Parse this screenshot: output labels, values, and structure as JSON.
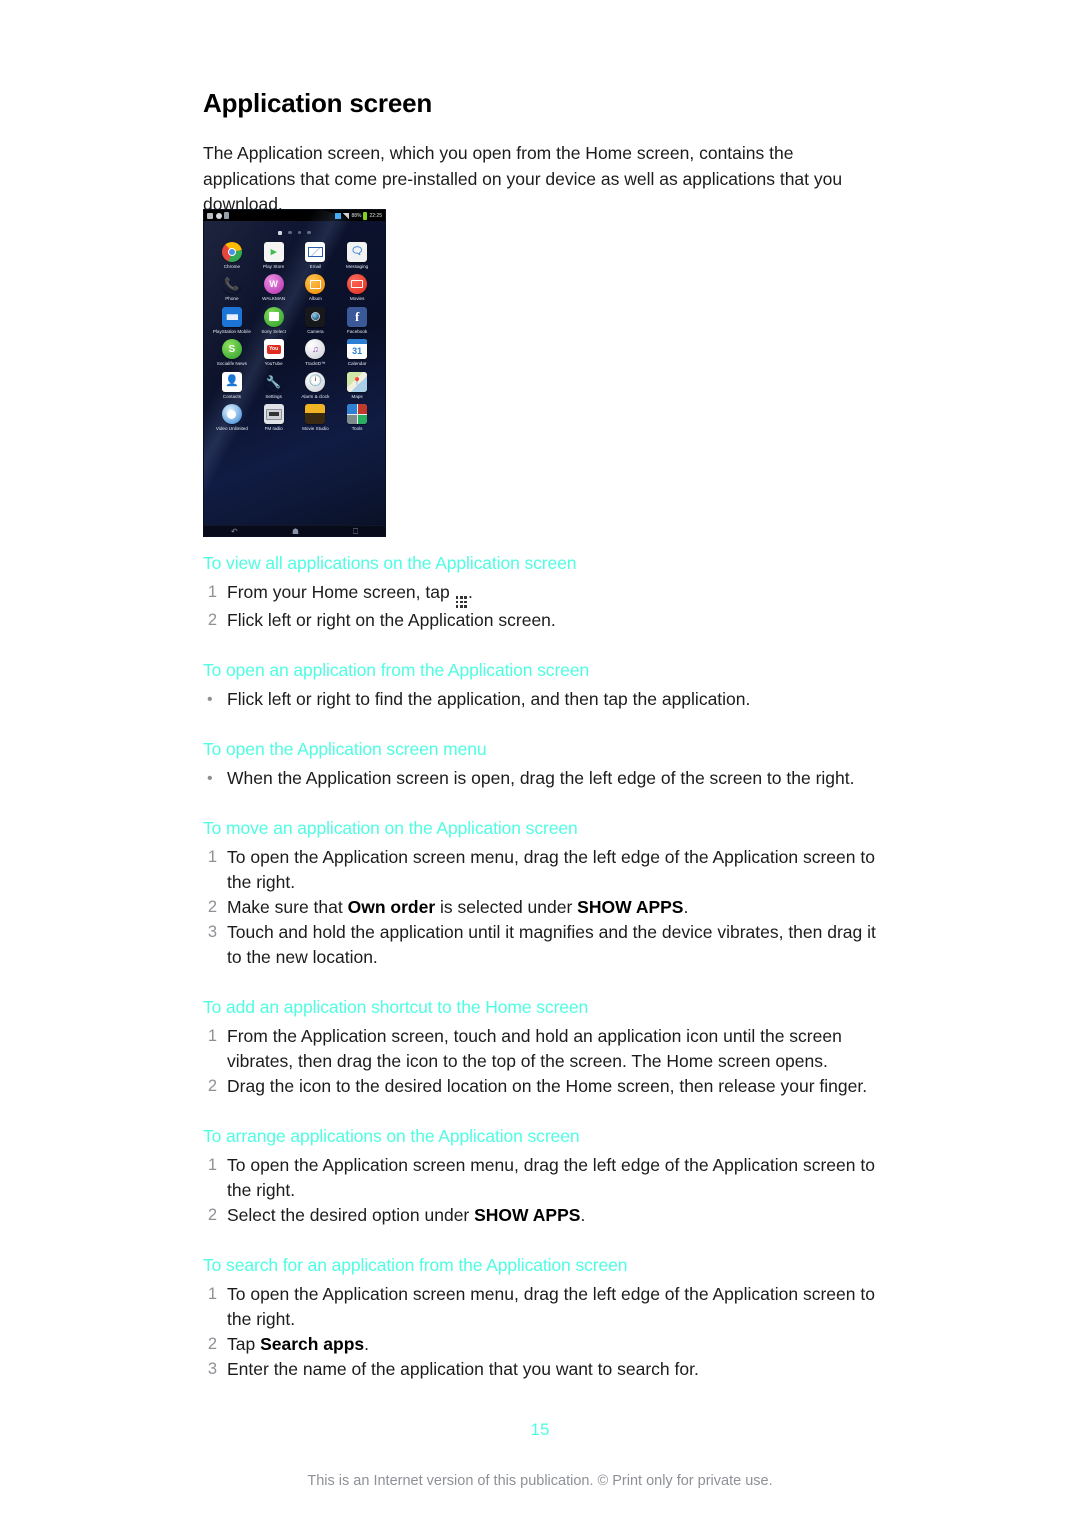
{
  "document": {
    "title": "Application screen",
    "intro": "The Application screen, which you open from the Home screen, contains the applications that come pre-installed on your device as well as applications that you download.",
    "page_number": "15",
    "footer": "This is an Internet version of this publication. © Print only for private use.",
    "heading_color": "#4FFEE2",
    "body_color": "#1c1c1c",
    "muted_color": "#8d9196"
  },
  "figure": {
    "name": "application-screen-phone-screenshot",
    "statusbar": {
      "battery": "88%",
      "clock": "22:25"
    },
    "page_indicator": {
      "total": 4,
      "selected": 1
    },
    "apps": [
      {
        "label": "Chrome",
        "icon": "chrome-icon"
      },
      {
        "label": "Play Store",
        "icon": "play-store-icon"
      },
      {
        "label": "Email",
        "icon": "email-icon"
      },
      {
        "label": "Messaging",
        "icon": "messaging-icon"
      },
      {
        "label": "Phone",
        "icon": "phone-icon"
      },
      {
        "label": "WALKMAN",
        "icon": "walkman-icon"
      },
      {
        "label": "Album",
        "icon": "album-icon"
      },
      {
        "label": "Movies",
        "icon": "movies-icon"
      },
      {
        "label": "PlayStation Mobile",
        "icon": "playstation-mobile-icon"
      },
      {
        "label": "Sony Select",
        "icon": "sony-select-icon"
      },
      {
        "label": "Camera",
        "icon": "camera-icon"
      },
      {
        "label": "Facebook",
        "icon": "facebook-icon"
      },
      {
        "label": "Socialife News",
        "icon": "socialife-news-icon"
      },
      {
        "label": "YouTube",
        "icon": "youtube-icon"
      },
      {
        "label": "TrackID™",
        "icon": "trackid-icon"
      },
      {
        "label": "Calendar",
        "icon": "calendar-icon"
      },
      {
        "label": "Contacts",
        "icon": "contacts-icon"
      },
      {
        "label": "Settings",
        "icon": "settings-icon"
      },
      {
        "label": "Alarm & clock",
        "icon": "alarm-clock-icon"
      },
      {
        "label": "Maps",
        "icon": "maps-icon"
      },
      {
        "label": "Video Unlimited",
        "icon": "video-unlimited-icon"
      },
      {
        "label": "FM radio",
        "icon": "fm-radio-icon"
      },
      {
        "label": "Movie Studio",
        "icon": "movie-studio-icon"
      },
      {
        "label": "Tools",
        "icon": "tools-icon"
      }
    ],
    "navbar": [
      "back-icon",
      "home-icon",
      "recents-icon"
    ]
  },
  "procedures": [
    {
      "title": "To view all applications on the Application screen",
      "list_type": "ordered",
      "steps": [
        {
          "marker": "1",
          "parts": [
            {
              "t": "From your Home screen, tap "
            },
            {
              "icon": "app-drawer-icon"
            },
            {
              "t": "."
            }
          ]
        },
        {
          "marker": "2",
          "parts": [
            {
              "t": "Flick left or right on the Application screen."
            }
          ]
        }
      ]
    },
    {
      "title": "To open an application from the Application screen",
      "list_type": "bullet",
      "steps": [
        {
          "marker": "•",
          "parts": [
            {
              "t": "Flick left or right to find the application, and then tap the application."
            }
          ]
        }
      ]
    },
    {
      "title": "To open the Application screen menu",
      "list_type": "bullet",
      "steps": [
        {
          "marker": "•",
          "parts": [
            {
              "t": "When the Application screen is open, drag the left edge of the screen to the right."
            }
          ]
        }
      ]
    },
    {
      "title": "To move an application on the Application screen",
      "list_type": "ordered",
      "steps": [
        {
          "marker": "1",
          "parts": [
            {
              "t": "To open the Application screen menu, drag the left edge of the Application screen to the right."
            }
          ]
        },
        {
          "marker": "2",
          "parts": [
            {
              "t": "Make sure that "
            },
            {
              "t": "Own order",
              "b": true
            },
            {
              "t": " is selected under "
            },
            {
              "t": "SHOW APPS",
              "b": true
            },
            {
              "t": "."
            }
          ]
        },
        {
          "marker": "3",
          "parts": [
            {
              "t": "Touch and hold the application until it magnifies and the device vibrates, then drag it to the new location."
            }
          ]
        }
      ]
    },
    {
      "title": "To add an application shortcut to the Home screen",
      "list_type": "ordered",
      "steps": [
        {
          "marker": "1",
          "parts": [
            {
              "t": "From the Application screen, touch and hold an application icon until the screen vibrates, then drag the icon to the top of the screen. The Home screen opens."
            }
          ]
        },
        {
          "marker": "2",
          "parts": [
            {
              "t": "Drag the icon to the desired location on the Home screen, then release your finger."
            }
          ]
        }
      ]
    },
    {
      "title": "To arrange applications on the Application screen",
      "list_type": "ordered",
      "steps": [
        {
          "marker": "1",
          "parts": [
            {
              "t": "To open the Application screen menu, drag the left edge of the Application screen to the right."
            }
          ]
        },
        {
          "marker": "2",
          "parts": [
            {
              "t": "Select the desired option under "
            },
            {
              "t": "SHOW APPS",
              "b": true
            },
            {
              "t": "."
            }
          ]
        }
      ]
    },
    {
      "title": "To search for an application from the Application screen",
      "list_type": "ordered",
      "steps": [
        {
          "marker": "1",
          "parts": [
            {
              "t": "To open the Application screen menu, drag the left edge of the Application screen to the right."
            }
          ]
        },
        {
          "marker": "2",
          "parts": [
            {
              "t": "Tap "
            },
            {
              "t": "Search apps",
              "b": true
            },
            {
              "t": "."
            }
          ]
        },
        {
          "marker": "3",
          "parts": [
            {
              "t": "Enter the name of the application that you want to search for."
            }
          ]
        }
      ]
    }
  ]
}
